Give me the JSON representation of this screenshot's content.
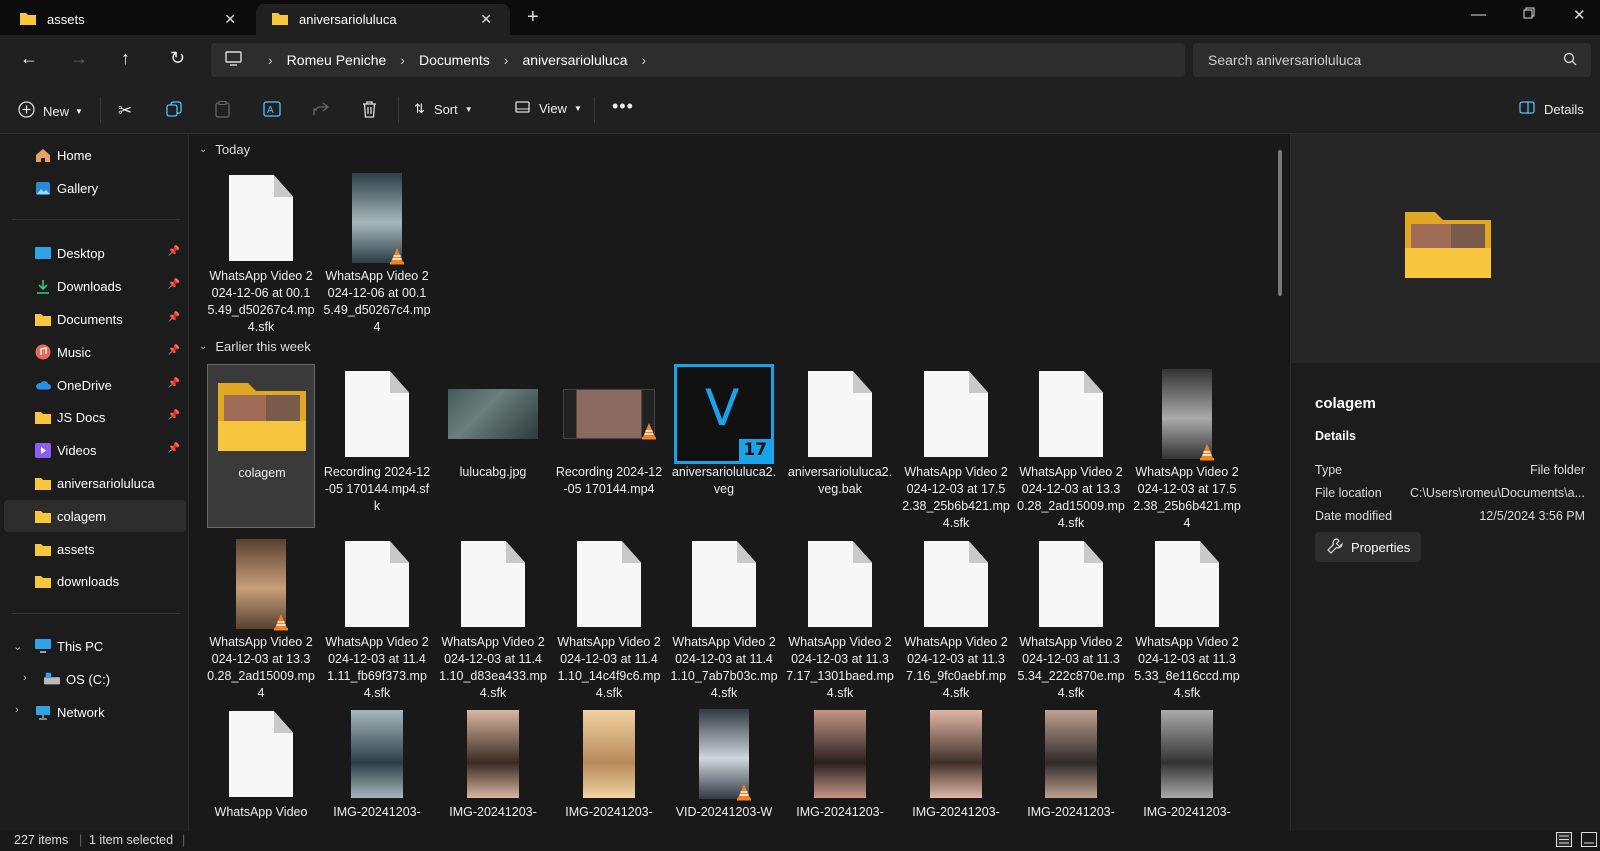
{
  "tabs": [
    {
      "label": "assets",
      "icon": "folder-icon"
    },
    {
      "label": "aniversarioluluca",
      "icon": "folder-icon"
    }
  ],
  "window": {
    "minimize": "minimize-icon",
    "restore": "restore-icon",
    "close": "close-icon"
  },
  "breadcrumb": [
    "Romeu Peniche",
    "Documents",
    "aniversarioluluca"
  ],
  "search": {
    "placeholder": "Search aniversarioluluca"
  },
  "toolbar": {
    "new_label": "New",
    "sort_label": "Sort",
    "view_label": "View",
    "details_label": "Details"
  },
  "sidebar": {
    "top": [
      {
        "label": "Home",
        "icon": "home-icon"
      },
      {
        "label": "Gallery",
        "icon": "gallery-icon"
      }
    ],
    "pinned": [
      {
        "label": "Desktop",
        "icon": "desktop-icon"
      },
      {
        "label": "Downloads",
        "icon": "download-icon"
      },
      {
        "label": "Documents",
        "icon": "folder-icon"
      },
      {
        "label": "Music",
        "icon": "music-icon"
      },
      {
        "label": "OneDrive",
        "icon": "cloud-icon"
      },
      {
        "label": "JS Docs",
        "icon": "folder-icon"
      },
      {
        "label": "Videos",
        "icon": "video-icon"
      },
      {
        "label": "aniversarioluluca",
        "icon": "folder-icon"
      },
      {
        "label": "colagem",
        "icon": "folder-icon"
      },
      {
        "label": "assets",
        "icon": "folder-icon"
      },
      {
        "label": "downloads",
        "icon": "folder-icon"
      }
    ],
    "tree": [
      {
        "label": "This PC",
        "icon": "pc-icon"
      },
      {
        "label": "OS (C:)",
        "icon": "drive-icon"
      },
      {
        "label": "Network",
        "icon": "network-icon"
      }
    ]
  },
  "groups": {
    "today": "Today",
    "week": "Earlier this week"
  },
  "files": {
    "today": [
      {
        "name": "WhatsApp Video 2024-12-06 at 00.15.49_d50267c4.mp4.sfk",
        "kind": "doc"
      },
      {
        "name": "WhatsApp Video 2024-12-06 at 00.15.49_d50267c4.mp4",
        "kind": "video"
      }
    ],
    "row1": [
      {
        "name": "colagem",
        "kind": "folder"
      },
      {
        "name": "Recording 2024-12-05 170144.mp4.sfk",
        "kind": "doc"
      },
      {
        "name": "lulucabg.jpg",
        "kind": "image"
      },
      {
        "name": "Recording 2024-12-05 170144.mp4",
        "kind": "video-wide"
      },
      {
        "name": "aniversarioluluca2.veg",
        "kind": "vegas"
      },
      {
        "name": "aniversarioluluca2.veg.bak",
        "kind": "doc"
      },
      {
        "name": "WhatsApp Video 2024-12-03 at 17.52.38_25b6b421.mp4.sfk",
        "kind": "doc"
      },
      {
        "name": "WhatsApp Video 2024-12-03 at 13.30.28_2ad15009.mp4.sfk",
        "kind": "doc"
      },
      {
        "name": "WhatsApp Video 2024-12-03 at 17.52.38_25b6b421.mp4",
        "kind": "video"
      }
    ],
    "row2": [
      {
        "name": "WhatsApp Video 2024-12-03 at 13.30.28_2ad15009.mp4",
        "kind": "video"
      },
      {
        "name": "WhatsApp Video 2024-12-03 at 11.41.11_fb69f373.mp4.sfk",
        "kind": "doc"
      },
      {
        "name": "WhatsApp Video 2024-12-03 at 11.41.10_d83ea433.mp4.sfk",
        "kind": "doc"
      },
      {
        "name": "WhatsApp Video 2024-12-03 at 11.41.10_14c4f9c6.mp4.sfk",
        "kind": "doc"
      },
      {
        "name": "WhatsApp Video 2024-12-03 at 11.41.10_7ab7b03c.mp4.sfk",
        "kind": "doc"
      },
      {
        "name": "WhatsApp Video 2024-12-03 at 11.37.17_1301baed.mp4.sfk",
        "kind": "doc"
      },
      {
        "name": "WhatsApp Video 2024-12-03 at 11.37.16_9fc0aebf.mp4.sfk",
        "kind": "doc"
      },
      {
        "name": "WhatsApp Video 2024-12-03 at 11.35.34_222c870e.mp4.sfk",
        "kind": "doc"
      },
      {
        "name": "WhatsApp Video 2024-12-03 at 11.35.33_8e116ccd.mp4.sfk",
        "kind": "doc"
      }
    ],
    "row3": [
      {
        "name": "WhatsApp Video",
        "kind": "doc"
      },
      {
        "name": "IMG-20241203-",
        "kind": "image"
      },
      {
        "name": "IMG-20241203-",
        "kind": "image"
      },
      {
        "name": "IMG-20241203-",
        "kind": "image"
      },
      {
        "name": "VID-20241203-W",
        "kind": "video"
      },
      {
        "name": "IMG-20241203-",
        "kind": "image"
      },
      {
        "name": "IMG-20241203-",
        "kind": "image"
      },
      {
        "name": "IMG-20241203-",
        "kind": "image"
      },
      {
        "name": "IMG-20241203-",
        "kind": "image"
      }
    ]
  },
  "details": {
    "name": "colagem",
    "heading": "Details",
    "rows": [
      {
        "key": "Type",
        "value": "File folder"
      },
      {
        "key": "File location",
        "value": "C:\\Users\\romeu\\Documents\\a..."
      },
      {
        "key": "Date modified",
        "value": "12/5/2024 3:56 PM"
      }
    ],
    "properties_label": "Properties"
  },
  "status": {
    "items": "227 items",
    "selected": "1 item selected"
  },
  "colors": {
    "accent": "#4cc2ff",
    "folder": "#f8c63d",
    "vegas": "#1aa3e8"
  }
}
